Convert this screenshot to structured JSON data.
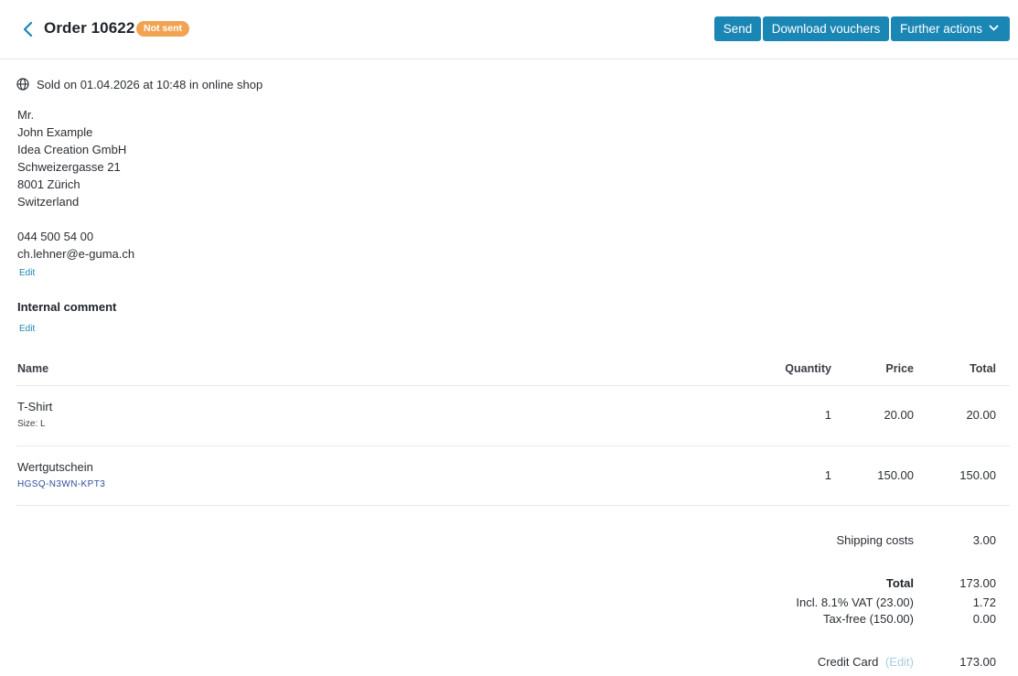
{
  "header": {
    "title": "Order 10622",
    "status_badge": "Not sent",
    "buttons": {
      "send": "Send",
      "download": "Download vouchers",
      "more": "Further actions"
    },
    "colors": {
      "primary": "#1a86b4",
      "badge": "#f2a352"
    }
  },
  "sale_info": "Sold on 01.04.2026 at 10:48 in online shop",
  "customer": {
    "salutation": "Mr.",
    "name": "John Example",
    "company": "Idea Creation GmbH",
    "street": "Schweizergasse 21",
    "city": "8001 Zürich",
    "country": "Switzerland",
    "phone": "044 500 54 00",
    "email": "ch.lehner@e-guma.ch",
    "edit_label": "Edit"
  },
  "internal_comment": {
    "heading": "Internal comment",
    "edit_label": "Edit"
  },
  "table": {
    "headers": {
      "name": "Name",
      "quantity": "Quantity",
      "price": "Price",
      "total": "Total"
    },
    "rows": [
      {
        "name": "T-Shirt",
        "detail": "Size: L",
        "quantity": "1",
        "price": "20.00",
        "total": "20.00"
      },
      {
        "name": "Wertgutschein",
        "detail": "HGSQ-N3WN-KPT3",
        "quantity": "1",
        "price": "150.00",
        "total": "150.00"
      }
    ]
  },
  "summary": {
    "shipping_label": "Shipping costs",
    "shipping_value": "3.00",
    "total_label": "Total",
    "total_value": "173.00",
    "vat_label": "Incl. 8.1% VAT (23.00)",
    "vat_value": "1.72",
    "taxfree_label": "Tax-free (150.00)",
    "taxfree_value": "0.00",
    "payment_label": "Credit Card",
    "payment_edit": "(Edit)",
    "payment_value": "173.00"
  }
}
